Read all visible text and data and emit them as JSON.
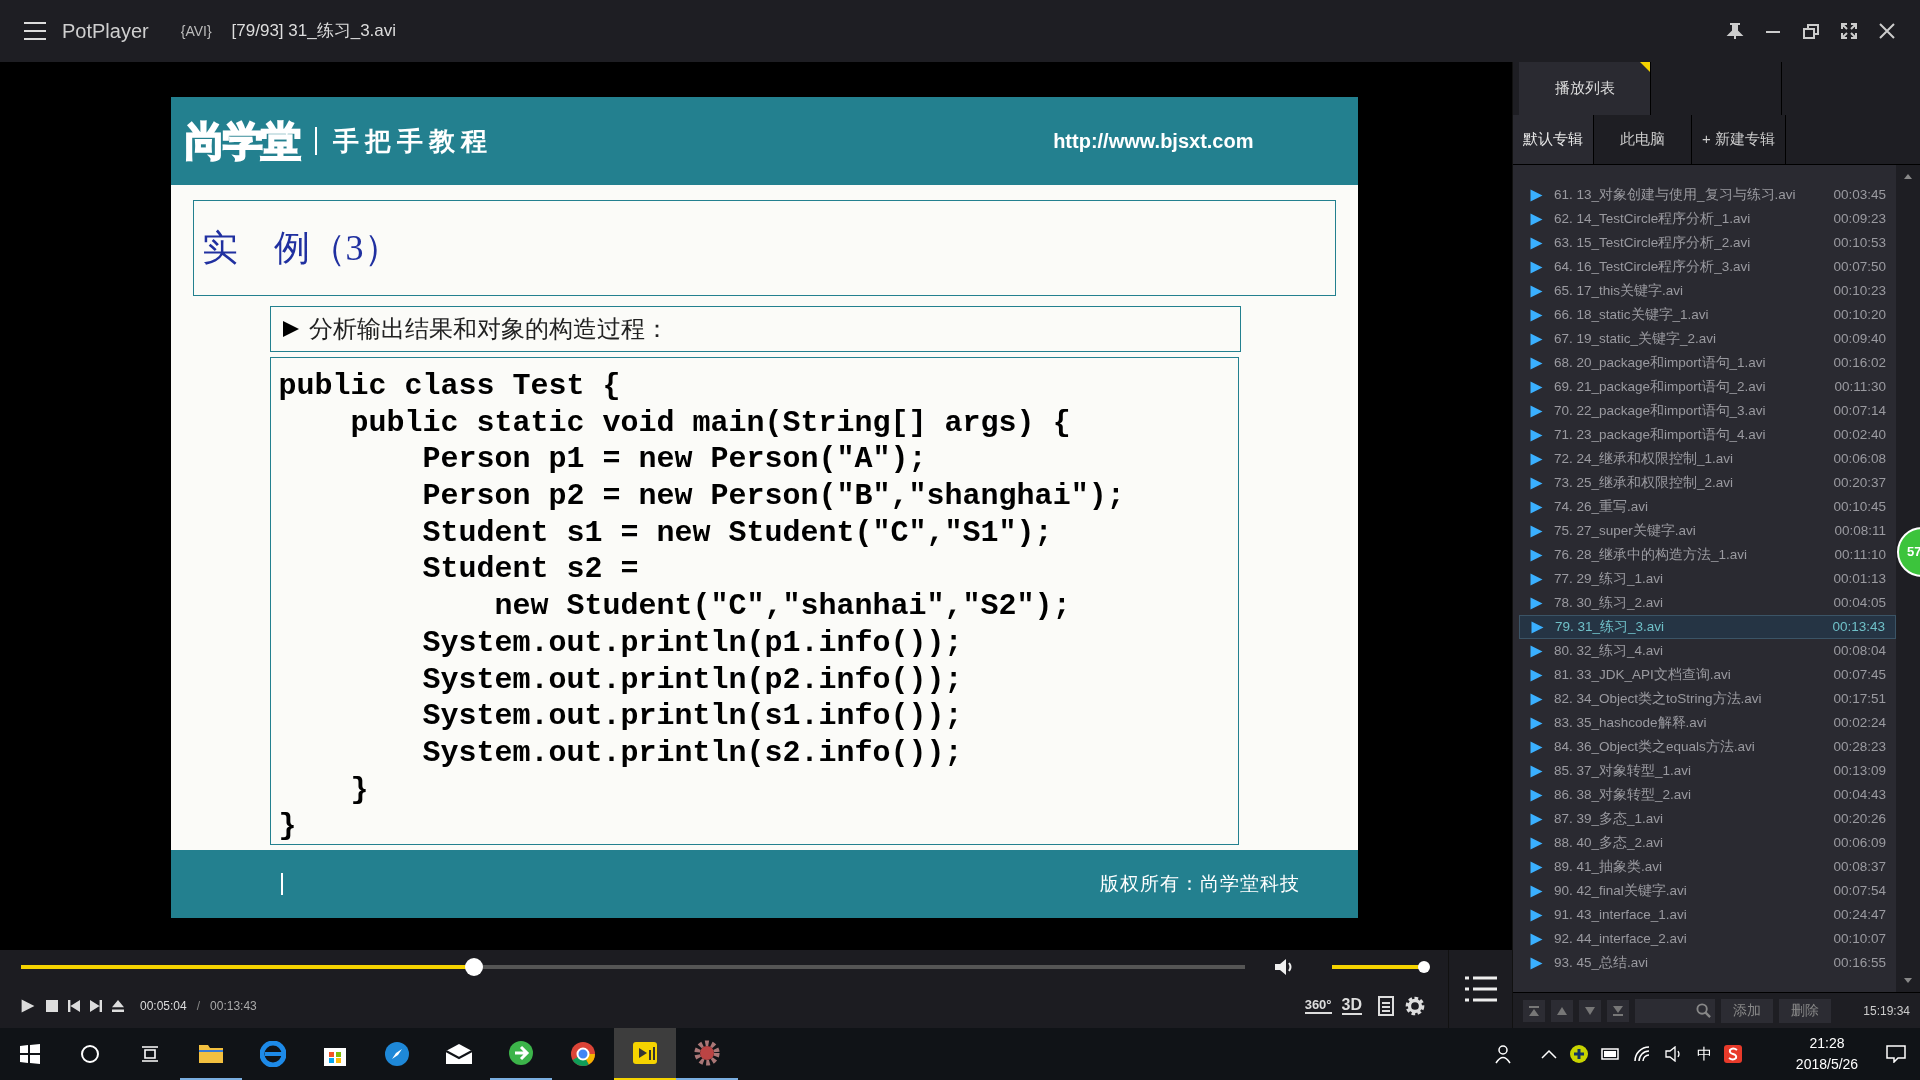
{
  "window": {
    "app": "PotPlayer",
    "format": "{AVI}",
    "title": "[79/93] 31_练习_3.avi"
  },
  "slide": {
    "logo": "尚学堂",
    "tagline": "手把手教程",
    "url": "http://www.bjsxt.com",
    "heading": "实　例（3）",
    "bullet": "分析输出结果和对象的构造过程：",
    "code": [
      "public class Test {",
      "    public static void main(String[] args) {",
      "        Person p1 = new Person(\"A\");",
      "        Person p2 = new Person(\"B\",\"shanghai\");",
      "        Student s1 = new Student(\"C\",\"S1\");",
      "        Student s2 =",
      "            new Student(\"C\",\"shanhai\",\"S2\");",
      "        System.out.println(p1.info());",
      "        System.out.println(p2.info());",
      "        System.out.println(s1.info());",
      "        System.out.println(s2.info());",
      "    }",
      "}"
    ],
    "footer": "版权所有：尚学堂科技"
  },
  "controls": {
    "progress": {
      "level": 0.37
    },
    "current_time": "00:05:04",
    "separator": "/",
    "total_time": "00:13:43",
    "volume": {
      "level": 1.0
    },
    "buttons": [
      "360°",
      "3D"
    ]
  },
  "playlist": {
    "tabs": [
      {
        "label": "播放列表",
        "selected": true
      }
    ],
    "albums": [
      {
        "label": "默认专辑",
        "selected": true
      },
      {
        "label": "此电脑",
        "selected": false
      },
      {
        "label": "+ 新建专辑",
        "selected": false
      }
    ],
    "items": [
      {
        "title": "61. 13_对象创建与使用_复习与练习.avi",
        "duration": "00:03:45",
        "selected": false
      },
      {
        "title": "62. 14_TestCircle程序分析_1.avi",
        "duration": "00:09:23",
        "selected": false
      },
      {
        "title": "63. 15_TestCircle程序分析_2.avi",
        "duration": "00:10:53",
        "selected": false
      },
      {
        "title": "64. 16_TestCircle程序分析_3.avi",
        "duration": "00:07:50",
        "selected": false
      },
      {
        "title": "65. 17_this关键字.avi",
        "duration": "00:10:23",
        "selected": false
      },
      {
        "title": "66. 18_static关键字_1.avi",
        "duration": "00:10:20",
        "selected": false
      },
      {
        "title": "67. 19_static_关键字_2.avi",
        "duration": "00:09:40",
        "selected": false
      },
      {
        "title": "68. 20_package和import语句_1.avi",
        "duration": "00:16:02",
        "selected": false
      },
      {
        "title": "69. 21_package和import语句_2.avi",
        "duration": "00:11:30",
        "selected": false
      },
      {
        "title": "70. 22_package和import语句_3.avi",
        "duration": "00:07:14",
        "selected": false
      },
      {
        "title": "71. 23_package和import语句_4.avi",
        "duration": "00:02:40",
        "selected": false
      },
      {
        "title": "72. 24_继承和权限控制_1.avi",
        "duration": "00:06:08",
        "selected": false
      },
      {
        "title": "73. 25_继承和权限控制_2.avi",
        "duration": "00:20:37",
        "selected": false
      },
      {
        "title": "74. 26_重写.avi",
        "duration": "00:10:45",
        "selected": false
      },
      {
        "title": "75. 27_super关键字.avi",
        "duration": "00:08:11",
        "selected": false
      },
      {
        "title": "76. 28_继承中的构造方法_1.avi",
        "duration": "00:11:10",
        "selected": false
      },
      {
        "title": "77. 29_练习_1.avi",
        "duration": "00:01:13",
        "selected": false
      },
      {
        "title": "78. 30_练习_2.avi",
        "duration": "00:04:05",
        "selected": false
      },
      {
        "title": "79. 31_练习_3.avi",
        "duration": "00:13:43",
        "selected": true
      },
      {
        "title": "80. 32_练习_4.avi",
        "duration": "00:08:04",
        "selected": false
      },
      {
        "title": "81. 33_JDK_API文档查询.avi",
        "duration": "00:07:45",
        "selected": false
      },
      {
        "title": "82. 34_Object类之toString方法.avi",
        "duration": "00:17:51",
        "selected": false
      },
      {
        "title": "83. 35_hashcode解释.avi",
        "duration": "00:02:24",
        "selected": false
      },
      {
        "title": "84. 36_Object类之equals方法.avi",
        "duration": "00:28:23",
        "selected": false
      },
      {
        "title": "85. 37_对象转型_1.avi",
        "duration": "00:13:09",
        "selected": false
      },
      {
        "title": "86. 38_对象转型_2.avi",
        "duration": "00:04:43",
        "selected": false
      },
      {
        "title": "87. 39_多态_1.avi",
        "duration": "00:20:26",
        "selected": false
      },
      {
        "title": "88. 40_多态_2.avi",
        "duration": "00:06:09",
        "selected": false
      },
      {
        "title": "89. 41_抽象类.avi",
        "duration": "00:08:37",
        "selected": false
      },
      {
        "title": "90. 42_final关键字.avi",
        "duration": "00:07:54",
        "selected": false
      },
      {
        "title": "91. 43_interface_1.avi",
        "duration": "00:24:47",
        "selected": false
      },
      {
        "title": "92. 44_interface_2.avi",
        "duration": "00:10:07",
        "selected": false
      },
      {
        "title": "93. 45_总结.avi",
        "duration": "00:16:55",
        "selected": false
      }
    ],
    "add_button": "添加",
    "delete_button": "删除",
    "clock": "15:19:34"
  },
  "floating_badge": "57",
  "taskbar": {
    "ime": "中",
    "time": "21:28",
    "date": "2018/5/26"
  }
}
